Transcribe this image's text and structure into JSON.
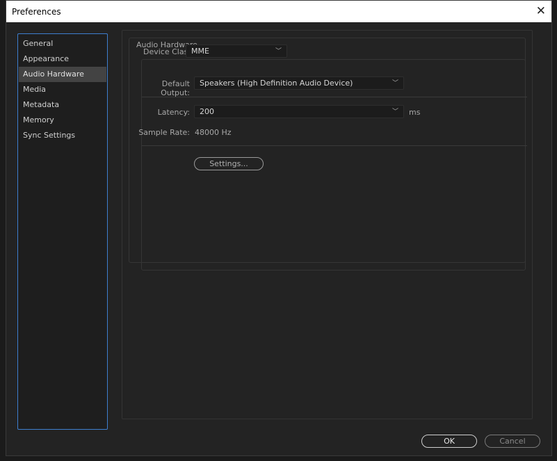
{
  "window": {
    "title": "Preferences",
    "close_icon": "close-icon"
  },
  "sidebar": {
    "items": [
      {
        "label": "General",
        "selected": false
      },
      {
        "label": "Appearance",
        "selected": false
      },
      {
        "label": "Audio Hardware",
        "selected": true
      },
      {
        "label": "Media",
        "selected": false
      },
      {
        "label": "Metadata",
        "selected": false
      },
      {
        "label": "Memory",
        "selected": false
      },
      {
        "label": "Sync Settings",
        "selected": false
      }
    ]
  },
  "audio_hardware": {
    "group_title": "Audio Hardware",
    "device_class": {
      "label": "Device Class:",
      "value": "MME"
    },
    "default_output": {
      "label": "Default Output:",
      "value": "Speakers (High Definition Audio Device)"
    },
    "latency": {
      "label": "Latency:",
      "value": "200",
      "unit": "ms"
    },
    "sample_rate": {
      "label": "Sample Rate:",
      "value": "48000 Hz"
    },
    "settings_button": "Settings..."
  },
  "footer": {
    "ok": "OK",
    "cancel": "Cancel"
  },
  "colors": {
    "selection_border": "#3e7fd0",
    "background": "#232323"
  }
}
